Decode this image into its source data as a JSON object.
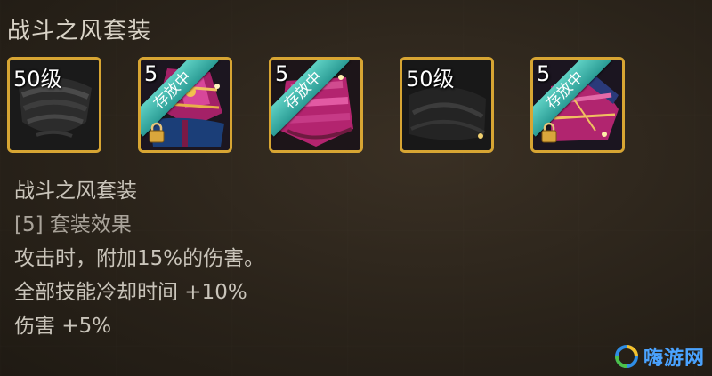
{
  "set_title": "战斗之风套装",
  "items": [
    {
      "level": "50级",
      "status": "",
      "locked": false
    },
    {
      "level": "5",
      "status": "存放中",
      "locked": true
    },
    {
      "level": "5",
      "status": "存放中",
      "locked": false
    },
    {
      "level": "50级",
      "status": "",
      "locked": false
    },
    {
      "level": "5",
      "status": "存放中",
      "locked": true
    }
  ],
  "details": {
    "name": "战斗之风套装",
    "set_effect_header": "[5] 套装效果",
    "effects": [
      "攻击时，附加15%的伤害。",
      "全部技能冷却时间 +10%",
      "伤害 +5%"
    ]
  },
  "watermark": {
    "text": "嗨游网"
  },
  "colors": {
    "slot_border": "#d7a533",
    "ribbon": "#3fb3a8",
    "purple_gear": "#b0256e"
  }
}
